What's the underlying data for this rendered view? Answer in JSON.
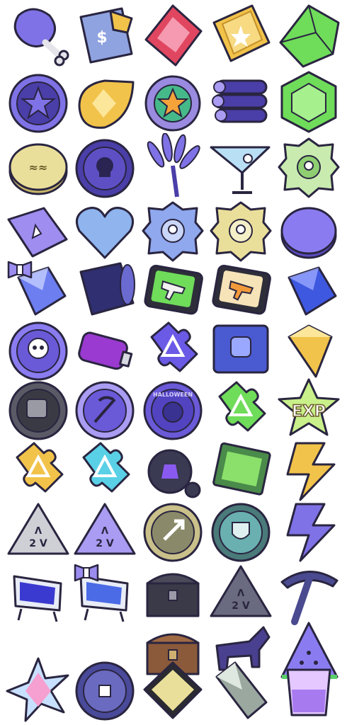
{
  "sheet": {
    "background": "#ffffff",
    "exp_label": "EXP",
    "halloween_label": "HALLOWEEN",
    "plate_label": "2 V",
    "colors": {
      "outline": "#2a2540",
      "purple": "#7f72e6",
      "purple_dark": "#4a3ea8",
      "gold": "#f2c34a",
      "green": "#6fdc5a",
      "red": "#e04660",
      "cream": "#eadf9a",
      "silver": "#cfcfd6"
    }
  },
  "icons": [
    {
      "name": "drumstick-icon",
      "row": 0,
      "col": 0
    },
    {
      "name": "money-bag-icon",
      "row": 0,
      "col": 1
    },
    {
      "name": "red-gem-icon",
      "row": 0,
      "col": 2
    },
    {
      "name": "golden-ticket-icon",
      "row": 0,
      "col": 3
    },
    {
      "name": "green-crystal-icon",
      "row": 0,
      "col": 4
    },
    {
      "name": "star-medal-icon",
      "row": 1,
      "col": 0
    },
    {
      "name": "gold-drop-icon",
      "row": 1,
      "col": 1
    },
    {
      "name": "star-badge-icon",
      "row": 1,
      "col": 2
    },
    {
      "name": "log-bundle-icon",
      "row": 1,
      "col": 3
    },
    {
      "name": "green-hex-gem-icon",
      "row": 1,
      "col": 4
    },
    {
      "name": "cream-coin-icon",
      "row": 2,
      "col": 0
    },
    {
      "name": "skull-coin-icon",
      "row": 2,
      "col": 1
    },
    {
      "name": "lavender-icon",
      "row": 2,
      "col": 2
    },
    {
      "name": "cocktail-icon",
      "row": 2,
      "col": 3
    },
    {
      "name": "crest-badge-green-icon",
      "row": 2,
      "col": 4
    },
    {
      "name": "purple-ticket-icon",
      "row": 3,
      "col": 0
    },
    {
      "name": "blue-heart-icon",
      "row": 3,
      "col": 1
    },
    {
      "name": "crest-badge-blue-icon",
      "row": 3,
      "col": 2
    },
    {
      "name": "crest-badge-cream-icon",
      "row": 3,
      "col": 3
    },
    {
      "name": "purple-coin-icon",
      "row": 3,
      "col": 4
    },
    {
      "name": "bow-crystal-icon",
      "row": 4,
      "col": 0
    },
    {
      "name": "barrel-icon",
      "row": 4,
      "col": 1
    },
    {
      "name": "green-gun-card-icon",
      "row": 4,
      "col": 2
    },
    {
      "name": "orange-gun-card-icon",
      "row": 4,
      "col": 3
    },
    {
      "name": "blue-crystal-icon",
      "row": 4,
      "col": 4
    },
    {
      "name": "skull-medal-icon",
      "row": 5,
      "col": 0
    },
    {
      "name": "spray-can-icon",
      "row": 5,
      "col": 1
    },
    {
      "name": "puzzle-purple-icon",
      "row": 5,
      "col": 2
    },
    {
      "name": "fist-card-icon",
      "row": 5,
      "col": 3
    },
    {
      "name": "yellow-diamond-icon",
      "row": 5,
      "col": 4
    },
    {
      "name": "dark-badge-icon",
      "row": 6,
      "col": 0
    },
    {
      "name": "scythe-coin-icon",
      "row": 6,
      "col": 1
    },
    {
      "name": "pumpkin-coin-icon",
      "row": 6,
      "col": 2
    },
    {
      "name": "puzzle-green-icon",
      "row": 6,
      "col": 3
    },
    {
      "name": "exp-star-icon",
      "row": 6,
      "col": 4
    },
    {
      "name": "puzzle-yellow-icon",
      "row": 7,
      "col": 0
    },
    {
      "name": "puzzle-cyan-icon",
      "row": 7,
      "col": 1
    },
    {
      "name": "dark-device-icon",
      "row": 7,
      "col": 2
    },
    {
      "name": "green-card-icon",
      "row": 7,
      "col": 3
    },
    {
      "name": "orange-bolt-icon",
      "row": 7,
      "col": 4
    },
    {
      "name": "triangle-plate-silver-icon",
      "row": 8,
      "col": 0
    },
    {
      "name": "triangle-plate-purple-icon",
      "row": 8,
      "col": 1
    },
    {
      "name": "arrow-medal-icon",
      "row": 8,
      "col": 2
    },
    {
      "name": "shield-medal-icon",
      "row": 8,
      "col": 3
    },
    {
      "name": "purple-bolt-icon",
      "row": 8,
      "col": 4
    },
    {
      "name": "blue-jar-icon",
      "row": 9,
      "col": 0
    },
    {
      "name": "bow-jar-icon",
      "row": 9,
      "col": 1
    },
    {
      "name": "treasure-chest-icon",
      "row": 9,
      "col": 2
    },
    {
      "name": "triangle-plate-grey-icon",
      "row": 9,
      "col": 3
    },
    {
      "name": "pickaxe-icon",
      "row": 9,
      "col": 4
    },
    {
      "name": "wooden-chest-icon",
      "row": 10,
      "col": 2
    },
    {
      "name": "dark-horse-icon",
      "row": 10,
      "col": 3
    },
    {
      "name": "watermelon-icon",
      "row": 10,
      "col": 4
    },
    {
      "name": "rainbow-star-icon",
      "row": 11,
      "col": 0
    },
    {
      "name": "ancient-coin-icon",
      "row": 11,
      "col": 1
    },
    {
      "name": "gold-lens-icon",
      "row": 11,
      "col": 2
    },
    {
      "name": "grey-crystal-icon",
      "row": 11,
      "col": 3
    },
    {
      "name": "purple-glass-icon",
      "row": 11,
      "col": 4
    }
  ]
}
